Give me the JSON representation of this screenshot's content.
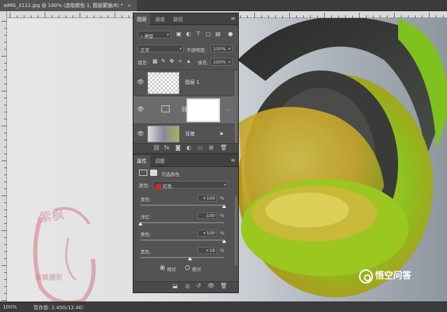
{
  "document_tab": {
    "title": "aIMG_2112.jpg @ 100% (选取颜色 1, 图层蒙版/8) *",
    "close": "×"
  },
  "status": {
    "zoom": "100%",
    "doc": "暂存盘: 2.45G/12.4G",
    "arrow": "›"
  },
  "canvas_watermark": {
    "big": "紫枫",
    "small": "紫枫摄影"
  },
  "panel": {
    "top_tabs": [
      "图层",
      "通道",
      "路径"
    ],
    "menu_icon": "≡",
    "kind_filter": "类型",
    "blend_mode": "正常",
    "opacity_label": "不透明度:",
    "opacity_value": "100%",
    "lock_label": "锁定:",
    "fill_label": "填充:",
    "fill_value": "100%",
    "layers": [
      {
        "name": "图层 1"
      },
      {
        "name": ""
      },
      {
        "name": "背景"
      }
    ],
    "bottom_tabs": [
      "属性",
      "调整"
    ],
    "prop_title": "可选颜色",
    "colors_label": "颜色:",
    "colors_value": "红色",
    "colors_swatch": "#d9261c",
    "sliders": [
      {
        "label": "青色:",
        "value": "+100",
        "unit": "%",
        "level": 1.0
      },
      {
        "label": "洋红:",
        "value": "-100",
        "unit": "%",
        "level": 0.0
      },
      {
        "label": "黄色:",
        "value": "+100",
        "unit": "%",
        "level": 1.0
      },
      {
        "label": "黑色:",
        "value": "+19",
        "unit": "%",
        "level": 0.595
      }
    ],
    "method_relative": "相对",
    "method_absolute": "绝对"
  },
  "brand": {
    "text": "悟空问答"
  }
}
